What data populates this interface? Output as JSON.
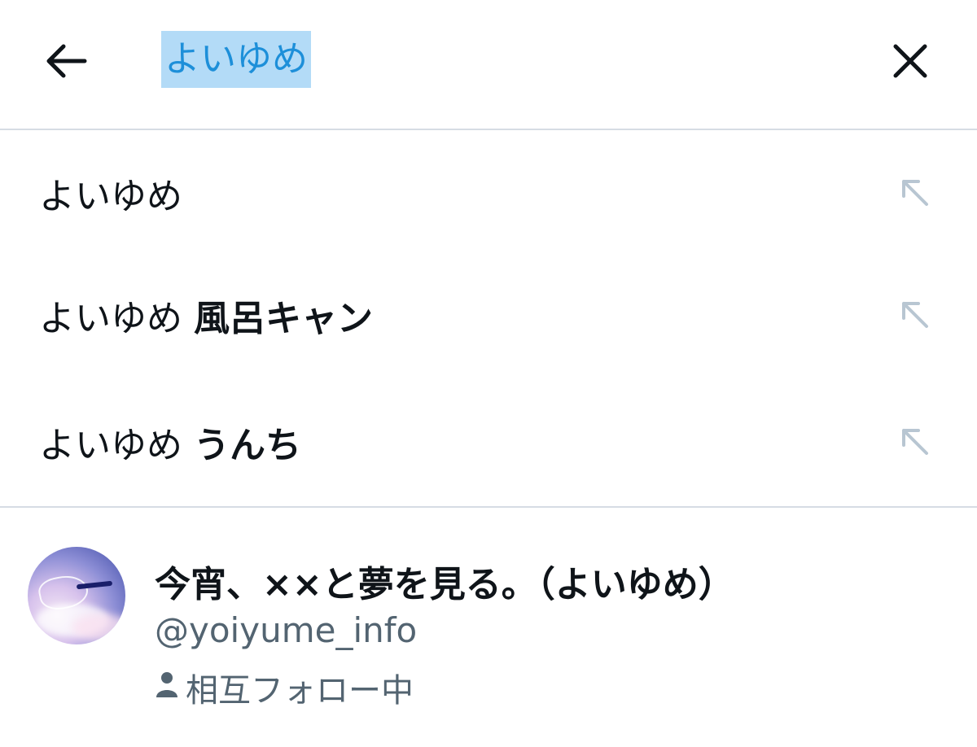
{
  "header": {
    "back_icon": "arrow-left-icon",
    "search_value": "よいゆめ",
    "clear_icon": "close-icon"
  },
  "suggestions": [
    {
      "prefix": "よいゆめ",
      "suffix": "",
      "icon": "arrow-up-left-icon"
    },
    {
      "prefix": "よいゆめ ",
      "suffix": "風呂キャン",
      "icon": "arrow-up-left-icon"
    },
    {
      "prefix": "よいゆめ ",
      "suffix": "うんち",
      "icon": "arrow-up-left-icon"
    }
  ],
  "user_result": {
    "display_name": "今宵、××と夢を見る。（よいゆめ）",
    "handle": "@yoiyume_info",
    "relationship": "相互フォロー中",
    "relationship_icon": "person-icon"
  },
  "colors": {
    "selection_bg": "#b3dbf7",
    "selection_text": "#1d8fd9",
    "secondary_text": "#536471",
    "fill_icon": "#b8c6d2",
    "divider": "#d6dce4"
  }
}
